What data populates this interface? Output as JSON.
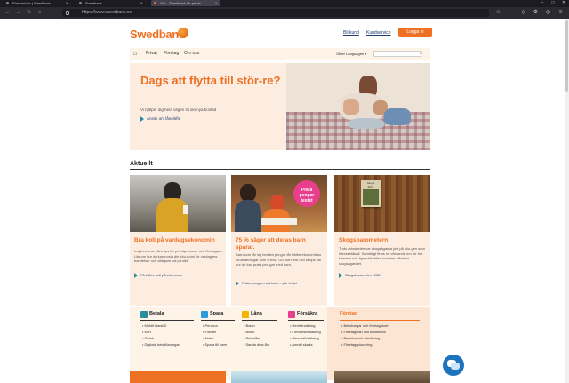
{
  "browser": {
    "tabs": [
      {
        "title": "Förstasidan | Swedbank"
      },
      {
        "title": "Swedbank"
      },
      {
        "title": "Gör - Swedbank för privat..."
      }
    ],
    "url": "https://www.swedbank.se"
  },
  "header": {
    "logo_text": "Swedbank",
    "bli_kund": "Bli kund",
    "kundservice": "Kundservice",
    "login": "Logga in"
  },
  "nav": {
    "items": [
      "Privat",
      "Företag",
      "Om oss"
    ],
    "other_languages": "Other Languages ▾"
  },
  "hero": {
    "title": "Dags att flytta till stör-re?",
    "subtitle": "Vi hjälper dig hela vägen till din nya bostad",
    "link": "Ansök om lånelöfte"
  },
  "section": {
    "title": "Aktuellt"
  },
  "cards": [
    {
      "title": "Bra koll på vardagsekonomin",
      "text": "Inspireras av våra tips för privatpersoner och företagare. Läs om hur du kan nosla din eko-nomi för vardagens handelser och viktigare val på sikt.",
      "link": "Få bättre koll på ekonomin"
    },
    {
      "title": "75 % säger att deras barn sparar.",
      "text": "Barn som får sig berätta pengar får bättre ekonomiska förutsättningar som vuxna. Gör kort test och få tips om hur du kan prata pen-gar med barn.",
      "link": "Prata pengar med barn – gör testet",
      "badge": "Prata pengar testet"
    },
    {
      "title": "Skogsbarometern",
      "text": "Trots ovissheten var skogsägarna just på sko-gen som intressetäkall. Samtidigt finns en väx-ande oro för hur klimatet och ägandekraften kommer påverka skogsägandet.",
      "link": "Skogsbarometern 2021",
      "badge": "Skogs 2021"
    }
  ],
  "footer_menu": {
    "columns": [
      {
        "title": "Betala",
        "items": [
          "Mobilt BankID",
          "Kort",
          "Swish",
          "Digitala betallösningar"
        ],
        "color": "#2b8d9d"
      },
      {
        "title": "Spara",
        "items": [
          "Pension",
          "Fonder",
          "Aktier",
          "Spara till barn"
        ],
        "color": "#2b9bd9"
      },
      {
        "title": "Låna",
        "items": [
          "Bolån",
          "Billån",
          "Privatlån",
          "Samla dina lån"
        ],
        "color": "#f4b400"
      },
      {
        "title": "Försäkra",
        "items": [
          "Hemförsäkring",
          "Fordonsförsäkring",
          "Personförsäkring",
          "Anmäl skada"
        ],
        "color": "#e83e8c"
      },
      {
        "title": "Företag",
        "items": [
          "Betalningar och företagskort",
          "Företagslån och finansiera",
          "Pension och försäkring",
          "Företagsplacering"
        ],
        "color": "#ee7023"
      }
    ],
    "privat_link": "Privat",
    "foretag_link": "Företag"
  }
}
